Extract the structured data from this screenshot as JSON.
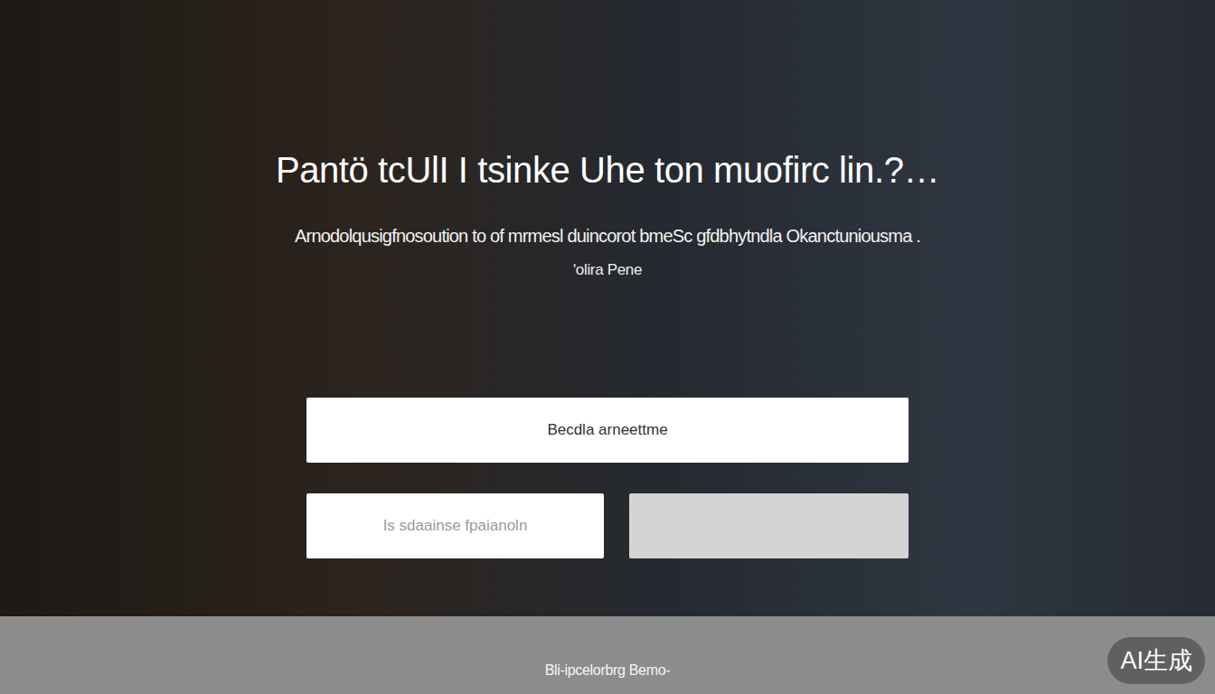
{
  "hero": {
    "title": "Pantö tcUlI I tsinke Uhe ton muofirc lin.?…",
    "subtitle": "Arnodolqusigfnosoution to of mrmesl duincorot bmeSc gfdbhytndla Okanctuniousma .",
    "caption": "'olira Pene"
  },
  "form": {
    "field": "Becdla arneettme",
    "secondary_button": "Is sdaainse fpaianoln",
    "primary_button_label_visible": false
  },
  "footer": {
    "text": "Bli-ipcelorbrg Bemo-"
  },
  "badge": {
    "text": "AI生成"
  }
}
